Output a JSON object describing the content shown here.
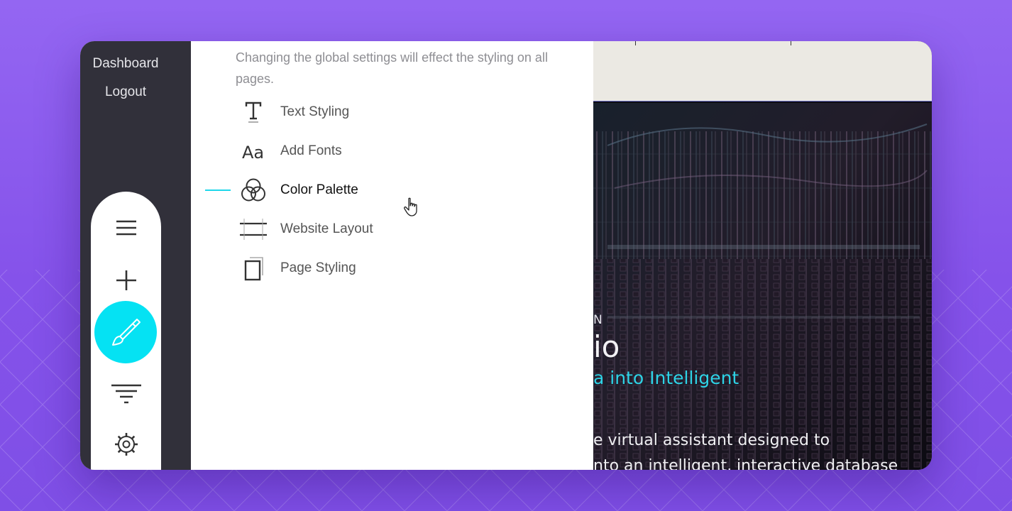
{
  "sidebar": {
    "links": [
      {
        "label": "Dashboard"
      },
      {
        "label": "Logout"
      }
    ]
  },
  "toolbar": {
    "tools": [
      {
        "icon": "hamburger-icon",
        "active": false
      },
      {
        "icon": "plus-icon",
        "active": false
      },
      {
        "icon": "paintbrush-icon",
        "active": true
      },
      {
        "icon": "filter-icon",
        "active": false
      },
      {
        "icon": "gear-icon",
        "active": false
      }
    ],
    "active_color": "#05e2f3"
  },
  "panel": {
    "description": "Changing the global settings will effect the styling on all pages.",
    "menu": [
      {
        "label": "Text Styling",
        "icon": "text-icon",
        "active": false
      },
      {
        "label": "Add Fonts",
        "icon": "fonts-icon",
        "active": false
      },
      {
        "label": "Color Palette",
        "icon": "color-palette-icon",
        "active": true
      },
      {
        "label": "Website Layout",
        "icon": "layout-icon",
        "active": false
      },
      {
        "label": "Page Styling",
        "icon": "page-icon",
        "active": false
      }
    ],
    "indicator_color": "#1fd7ea"
  },
  "preview": {
    "eyebrow": "N",
    "title": "io",
    "subtitle": "a into Intelligent",
    "body_line_1": "e virtual assistant designed to",
    "body_line_2": "nto an intelligent, interactive database",
    "subtitle_color": "#2ed3e6"
  }
}
